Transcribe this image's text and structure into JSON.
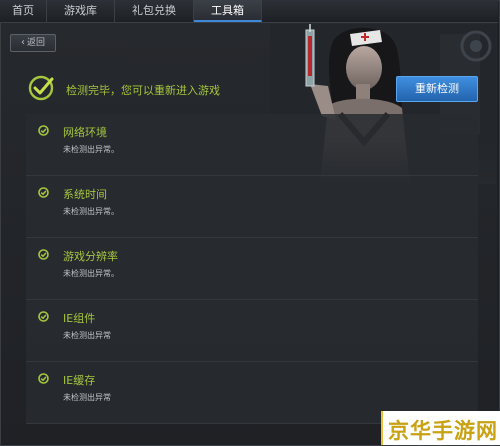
{
  "nav": {
    "tabs": [
      {
        "label": "首页"
      },
      {
        "label": "游戏库"
      },
      {
        "label": "礼包兑换"
      },
      {
        "label": "工具箱"
      }
    ],
    "active_index": 3
  },
  "back_button": {
    "label": "返回"
  },
  "header": {
    "status_text": "检测完毕，您可以重新进入游戏",
    "recheck_label": "重新检测"
  },
  "checks": [
    {
      "title": "网络环境",
      "result": "未检测出异常。"
    },
    {
      "title": "系统时间",
      "result": "未检测出异常。"
    },
    {
      "title": "游戏分辨率",
      "result": "未检测出异常。"
    },
    {
      "title": "IE组件",
      "result": "未检测出异常"
    },
    {
      "title": "IE缓存",
      "result": "未检测出异常"
    }
  ],
  "watermark": {
    "text": "京华手游网"
  },
  "colors": {
    "accent_green": "#a5c63e",
    "button_blue": "#2f7ccf",
    "background": "#1e2024",
    "watermark_gold": "#c8a213"
  }
}
